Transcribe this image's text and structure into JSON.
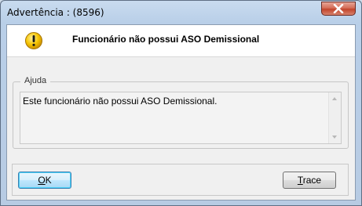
{
  "window": {
    "title": "Advertência : (8596)"
  },
  "message": {
    "icon": "warning-icon",
    "title": "Funcionário não possui ASO Demissional"
  },
  "help": {
    "legend": "Ajuda",
    "text": "Este funcionário não possui ASO Demissional."
  },
  "buttons": {
    "ok_label": "OK",
    "ok_mnemonic": "O",
    "ok_rest": "K",
    "trace_label": "Trace",
    "trace_mnemonic": "T",
    "trace_rest": "race"
  },
  "colors": {
    "warning_fill": "#f5c400",
    "close_button": "#c2442b"
  }
}
